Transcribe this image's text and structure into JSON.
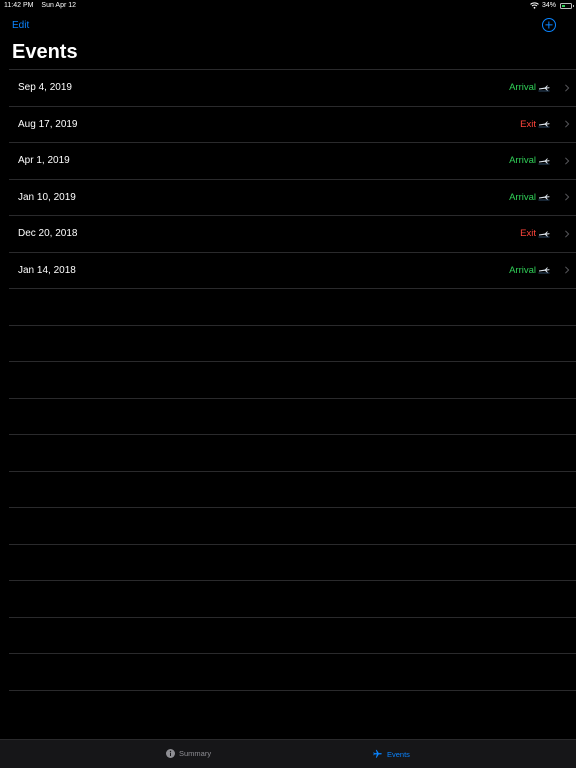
{
  "status_bar": {
    "time": "11:42 PM",
    "date": "Sun Apr 12",
    "battery": "34%",
    "battery_level": 0.34
  },
  "nav": {
    "edit_label": "Edit",
    "title": "Events"
  },
  "events": [
    {
      "date": "Sep 4, 2019",
      "type": "Arrival",
      "kind": "arrival"
    },
    {
      "date": "Aug 17, 2019",
      "type": "Exit",
      "kind": "exit"
    },
    {
      "date": "Apr 1, 2019",
      "type": "Arrival",
      "kind": "arrival"
    },
    {
      "date": "Jan 10, 2019",
      "type": "Arrival",
      "kind": "arrival"
    },
    {
      "date": "Dec 20, 2018",
      "type": "Exit",
      "kind": "exit"
    },
    {
      "date": "Jan 14, 2018",
      "type": "Arrival",
      "kind": "arrival"
    }
  ],
  "tabs": {
    "summary_label": "Summary",
    "events_label": "Events",
    "selected": "events"
  },
  "colors": {
    "accent": "#0a84ff",
    "arrival": "#30d158",
    "exit": "#ff453a",
    "background": "#000000"
  },
  "icons": {
    "add": "plus-circle-icon",
    "summary_tab": "info-circle-icon",
    "events_tab": "airplane-icon",
    "row_chevron": "chevron-right-icon",
    "row_type": "airplane-icon"
  }
}
